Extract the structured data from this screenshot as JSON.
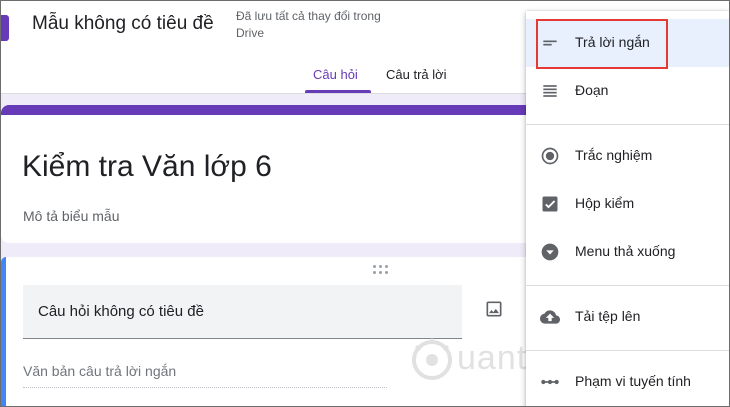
{
  "header": {
    "doc_title": "Mẫu không có tiêu đề",
    "save_status": "Đã lưu tất cả thay đổi trong Drive",
    "tabs": [
      {
        "label": "Câu hỏi",
        "active": true
      },
      {
        "label": "Câu trả lời",
        "active": false
      }
    ]
  },
  "form": {
    "title": "Kiểm tra Văn lớp 6",
    "description_placeholder": "Mô tả biểu mẫu"
  },
  "question": {
    "title_placeholder": "Câu hỏi không có tiêu đề",
    "answer_placeholder": "Văn bản câu trả lời ngắn"
  },
  "question_type_menu": {
    "items": [
      {
        "label": "Trả lời ngắn",
        "icon": "short-answer-icon",
        "selected": true
      },
      {
        "label": "Đoạn",
        "icon": "paragraph-icon",
        "selected": false
      },
      {
        "label": "Trắc nghiệm",
        "icon": "radio-button-icon",
        "selected": false
      },
      {
        "label": "Hộp kiểm",
        "icon": "checkbox-icon",
        "selected": false
      },
      {
        "label": "Menu thả xuống",
        "icon": "dropdown-icon",
        "selected": false
      },
      {
        "label": "Tải tệp lên",
        "icon": "cloud-upload-icon",
        "selected": false
      },
      {
        "label": "Phạm vi tuyến tính",
        "icon": "linear-scale-icon",
        "selected": false
      }
    ]
  },
  "watermark": {
    "text": "uantrimang"
  },
  "colors": {
    "theme": "#673ab7",
    "accent_blue": "#4285f4",
    "background": "#f0ebf8",
    "highlight": "#e53935",
    "menu_selected": "#e8f0fe"
  }
}
